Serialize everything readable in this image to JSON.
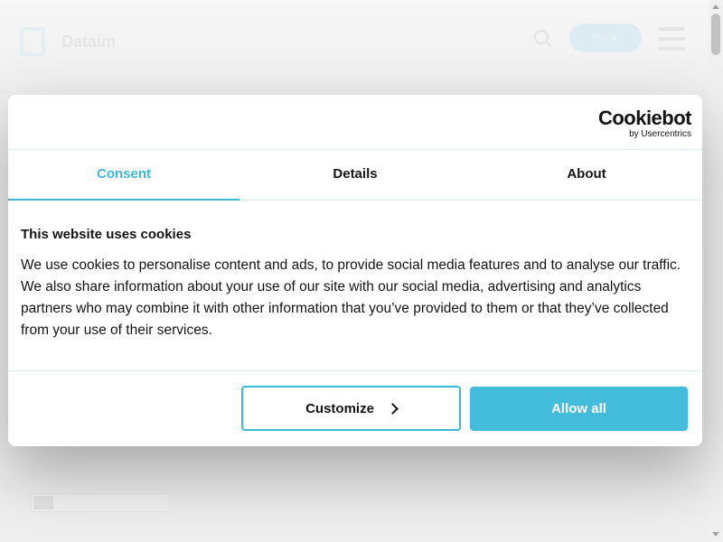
{
  "background": {
    "logo_text": "Dataim",
    "cta_label": "Book"
  },
  "dialog": {
    "brand": {
      "name": "Cookiebot",
      "sub": "by Usercentrics"
    },
    "tabs": [
      {
        "label": "Consent",
        "active": true
      },
      {
        "label": "Details",
        "active": false
      },
      {
        "label": "About",
        "active": false
      }
    ],
    "heading": "This website uses cookies",
    "body": "We use cookies to personalise content and ads, to provide social media features and to analyse our traffic. We also share information about your use of our site with our social media, advertising and analytics partners who may combine it with other information that you’ve provided to them or that they’ve collected from your use of their services.",
    "buttons": {
      "customize": "Customize",
      "allow_all": "Allow all"
    }
  },
  "colors": {
    "accent": "#3fb8d6",
    "allow_bg": "#44bcdc",
    "text": "#141414"
  },
  "icons": [
    "search-icon",
    "menu-icon",
    "chevron-right-icon",
    "logo-icon"
  ]
}
